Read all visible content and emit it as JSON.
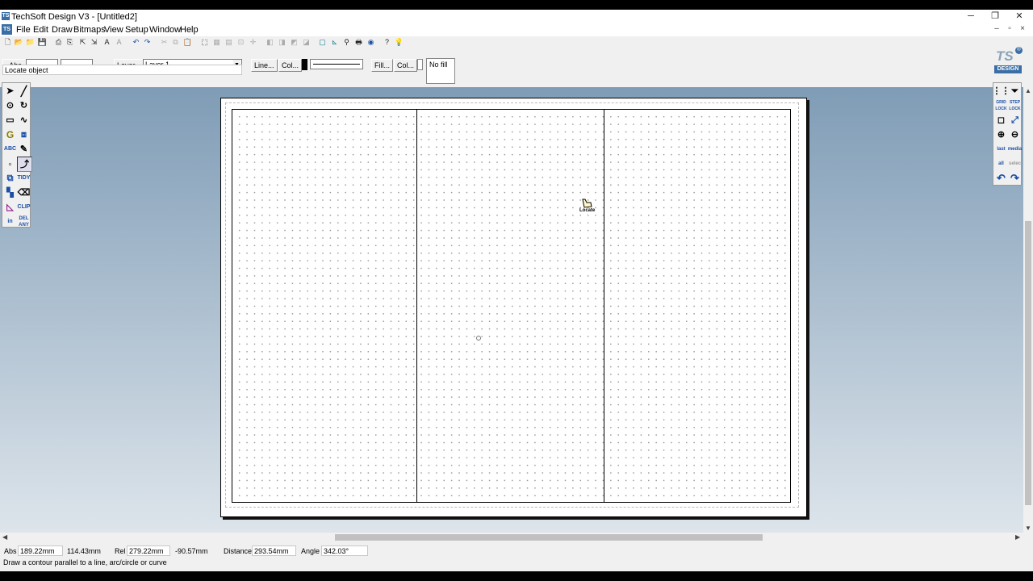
{
  "window": {
    "title": "TechSoft Design V3 - [Untitled2]",
    "app_icon": "TS"
  },
  "menu": [
    "File",
    "Edit",
    "Draw",
    "Bitmaps",
    "View",
    "Setup",
    "Window",
    "Help"
  ],
  "props": {
    "abs_label": "Abs",
    "layer_button": "Layer...",
    "layer_value": "Layer 1",
    "line_button": "Line...",
    "line_col_button": "Col...",
    "fill_button": "Fill...",
    "fill_col_button": "Col...",
    "no_fill": "No fill",
    "status_info": "Locate object"
  },
  "logo": {
    "top": "TS",
    "bottom": "DESIGN"
  },
  "left_tools": {
    "text_tool": "ABC",
    "tidy": "TIDY",
    "clip": "CLIP",
    "in": "in",
    "del_any": "DEL ANY"
  },
  "right_tools": {
    "grid_lock": "GRID LOCK",
    "step_lock": "STEP LOCK",
    "last": "last",
    "media": "media",
    "all": "all",
    "select": "selec"
  },
  "cursor_label": "Locate",
  "coords": {
    "abs_label": "Abs",
    "abs_x": "189.22mm",
    "abs_y": "114.43mm",
    "rel_label": "Rel",
    "rel_x": "279.22mm",
    "rel_y": "-90.57mm",
    "distance_label": "Distance",
    "distance": "293.54mm",
    "angle_label": "Angle",
    "angle": "342.03°"
  },
  "hint": "Draw a contour parallel to a line, arc/circle or curve",
  "colors": {
    "workspace_top": "#7f9cb6",
    "workspace_bottom": "#dfe6ec",
    "logo_blue": "#3a6ea5"
  }
}
